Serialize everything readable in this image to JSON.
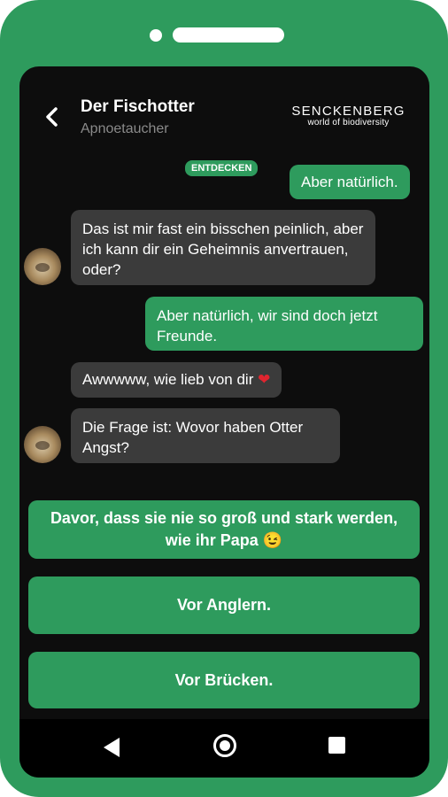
{
  "header": {
    "title": "Der Fischotter",
    "subtitle": "Apnoetaucher",
    "brand_name": "SENCKENBERG",
    "brand_tagline": "world of biodiversity"
  },
  "chat": {
    "tag": "ENTDECKEN",
    "messages": [
      {
        "sender": "user",
        "text": "Aber natürlich."
      },
      {
        "sender": "bot",
        "text": "Das ist mir fast ein bisschen peinlich, aber ich kann dir ein Geheimnis anvertrauen, oder?"
      },
      {
        "sender": "user",
        "text": "Aber natürlich, wir sind doch jetzt Freunde."
      },
      {
        "sender": "bot",
        "text": "Awwwww, wie lieb von dir",
        "emoji": "❤"
      },
      {
        "sender": "bot",
        "text": "Die Frage ist: Wovor haben Otter Angst?"
      }
    ]
  },
  "choices": [
    {
      "label": "Davor, dass sie nie so groß und stark werden, wie ihr Papa 😉"
    },
    {
      "label": "Vor Anglern."
    },
    {
      "label": "Vor Brücken."
    }
  ],
  "icons": {
    "back": "chevron-left-icon",
    "nav_back": "triangle-back-icon",
    "nav_home": "circle-home-icon",
    "nav_recent": "square-recent-icon"
  },
  "colors": {
    "accent": "#2e9b5d",
    "screen_bg": "#0d0d0d",
    "bot_bubble": "#3b3b3b"
  }
}
